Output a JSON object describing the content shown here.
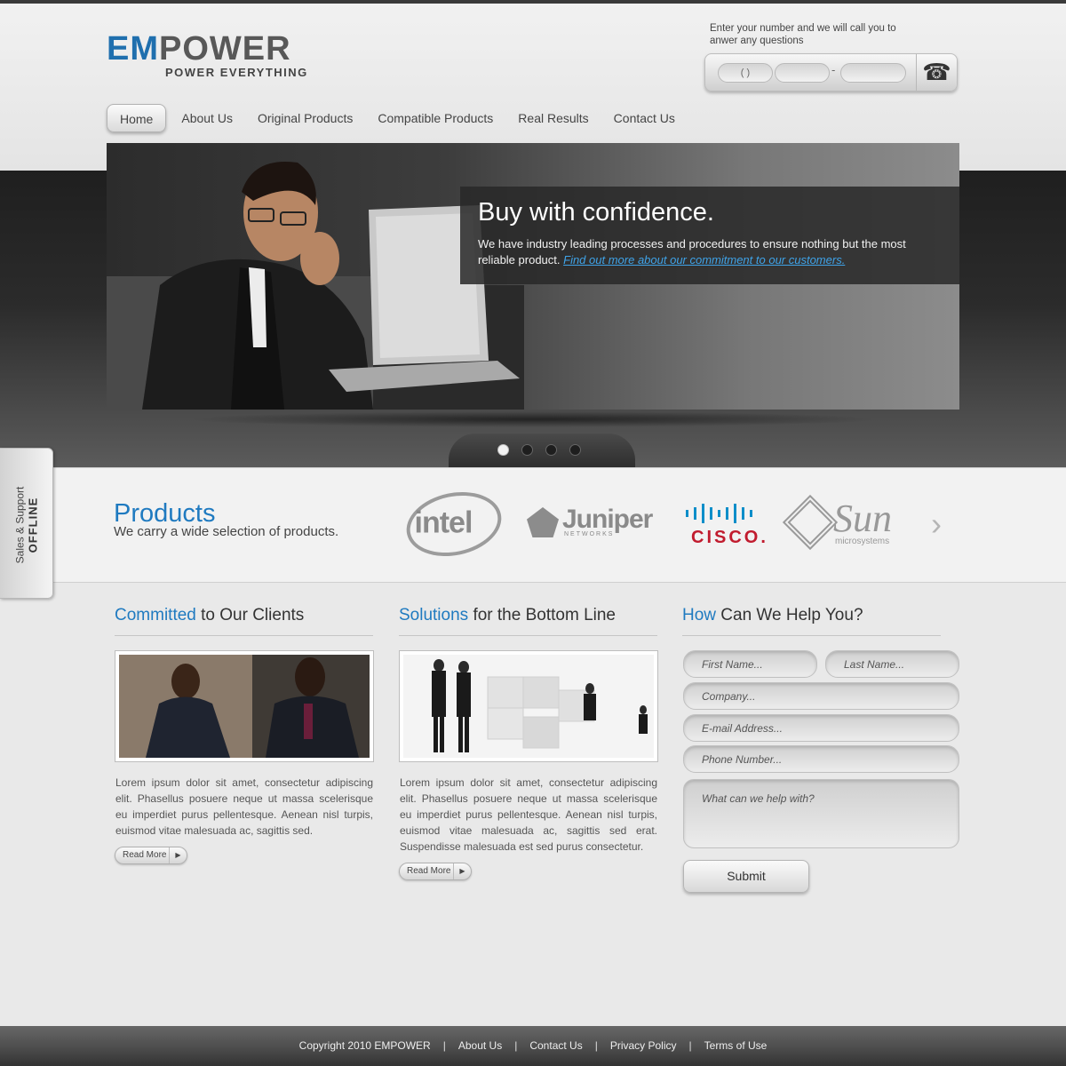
{
  "brand": {
    "logo_em": "EM",
    "logo_power": "POWER",
    "tagline": "POWER EVERYTHING",
    "accent_color": "#1f6fae"
  },
  "callback": {
    "text": "Enter your number and we will call you to anwer any questions",
    "area_value": "(        )",
    "dash": "-",
    "icon": "telephone-icon"
  },
  "nav": {
    "items": [
      "Home",
      "About Us",
      "Original Products",
      "Compatible Products",
      "Real Results",
      "Contact Us"
    ],
    "active": "Home"
  },
  "hero": {
    "title": "Buy with confidence.",
    "text": "We have industry leading processes and procedures to ensure nothing but the most reliable product.",
    "link": "Find out more about our commitment to our customers.",
    "slide_count": 4,
    "active_slide": 1
  },
  "products": {
    "title": "Products",
    "subtitle": "We carry a wide selection of products.",
    "logos": [
      "intel",
      "Juniper",
      "NETWORKS",
      "CISCO.",
      "Sun",
      "microsystems"
    ],
    "next_icon": "chevron-right-icon"
  },
  "side_tab": {
    "line1": "Sales & Support",
    "line2": "OFFLINE"
  },
  "columns": [
    {
      "title_hl": "Committed",
      "title_rest": " to Our Clients",
      "text": "Lorem ipsum dolor sit amet, consectetur adipiscing elit. Phasellus posuere neque ut massa scelerisque eu imperdiet purus pellentesque. Aenean nisl turpis, euismod vitae malesuada ac, sagittis sed.",
      "button": "Read More"
    },
    {
      "title_hl": "Solutions",
      "title_rest": " for the Bottom Line",
      "text": "Lorem ipsum dolor sit amet, consectetur adipiscing elit. Phasellus posuere neque ut massa scelerisque eu imperdiet purus pellentesque. Aenean nisl turpis, euismod vitae malesuada ac, sagittis sed erat. Suspendisse malesuada est sed purus consectetur.",
      "button": "Read More"
    }
  ],
  "form": {
    "title_hl": "How",
    "title_rest": " Can We Help You?",
    "first_name": "First Name...",
    "last_name": "Last Name...",
    "company": "Company...",
    "email": "E-mail Address...",
    "phone": "Phone Number...",
    "message": "What can we help with?",
    "submit": "Submit"
  },
  "footer": {
    "copyright": "Copyright 2010 EMPOWER",
    "links": [
      "About Us",
      "Contact Us",
      "Privacy Policy",
      "Terms of Use"
    ],
    "separator": "|"
  }
}
